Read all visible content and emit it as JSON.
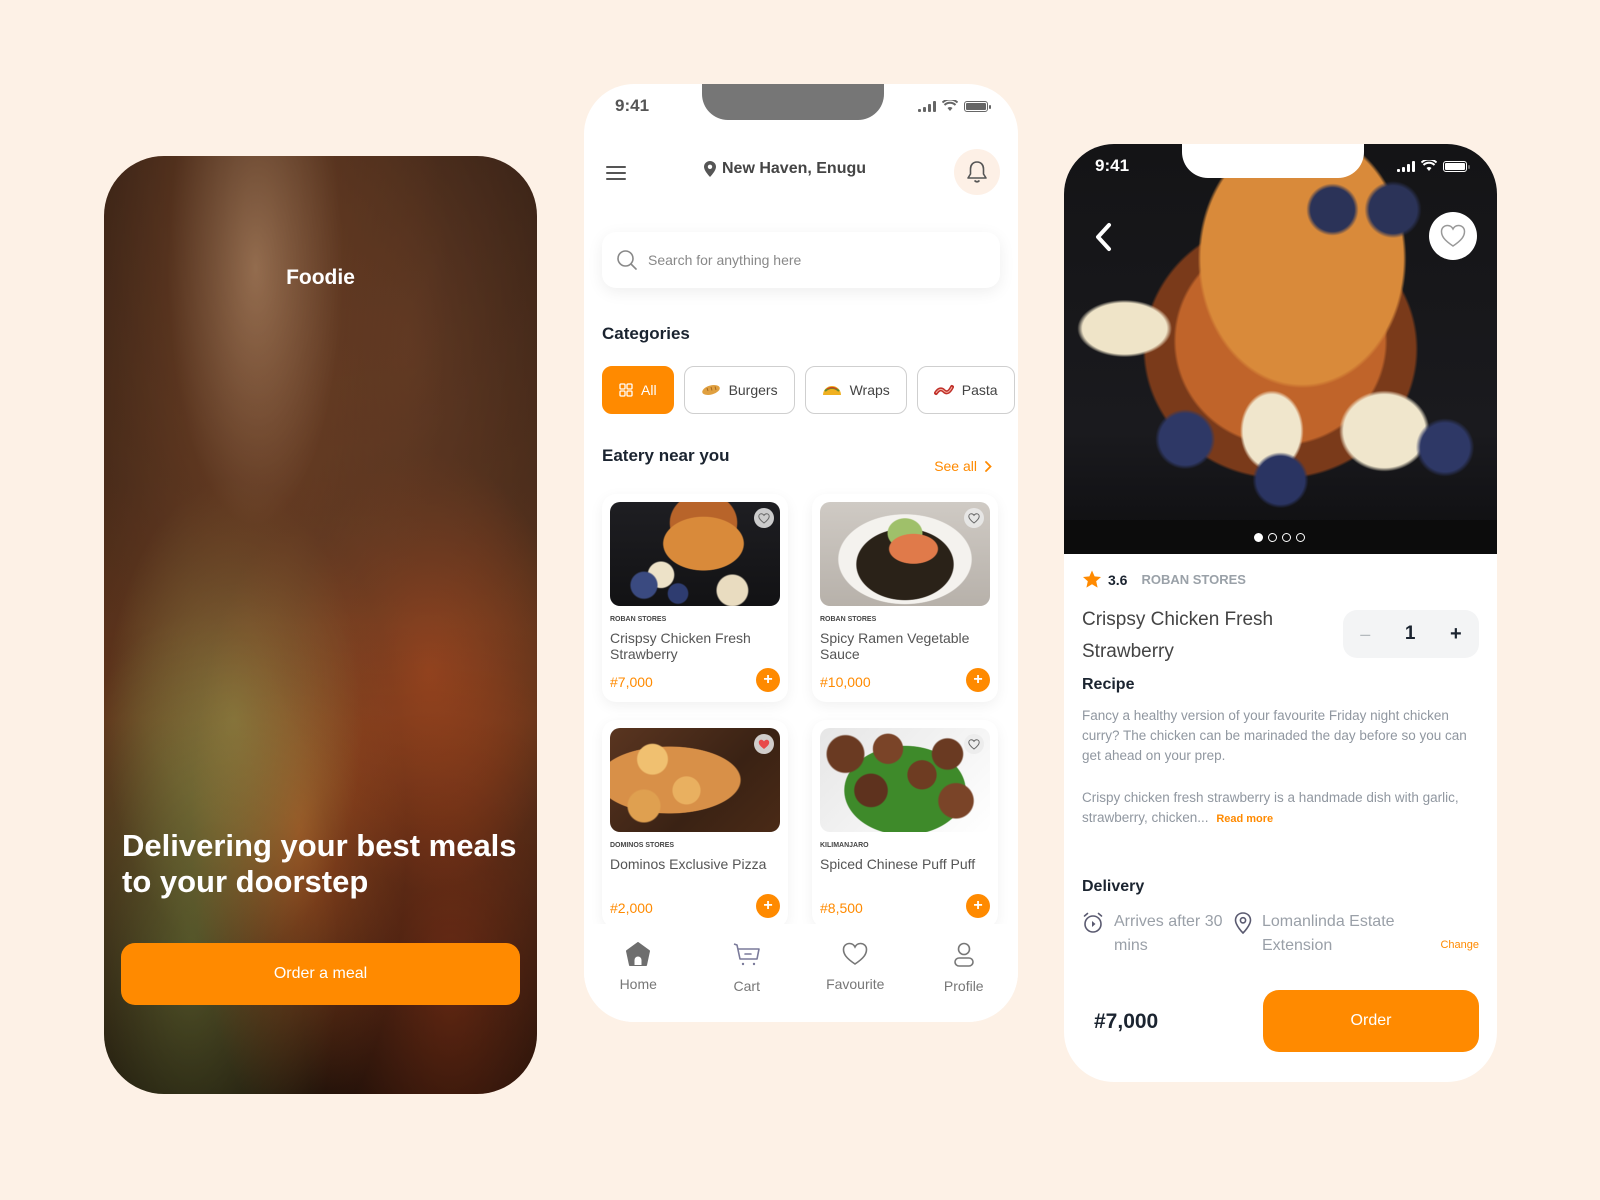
{
  "splash": {
    "brand": "Foodie",
    "headline": "Delivering your best meals to your doorstep",
    "cta_label": "Order a meal"
  },
  "home": {
    "status_time": "9:41",
    "location": "New Haven, Enugu",
    "search": {
      "placeholder": "Search for anything here"
    },
    "categories_title": "Categories",
    "categories": [
      {
        "label": "All",
        "icon": "grid-icon",
        "active": true
      },
      {
        "label": "Burgers",
        "icon": "bread-emoji",
        "active": false
      },
      {
        "label": "Wraps",
        "icon": "taco-emoji",
        "active": false
      },
      {
        "label": "Pasta",
        "icon": "bacon-emoji",
        "active": false
      }
    ],
    "eatery_title": "Eatery near you",
    "see_all_label": "See all",
    "eateries": [
      {
        "store": "ROBAN STORES",
        "name": "Crispsy Chicken Fresh Strawberry",
        "price": "#7,000",
        "favourited": false
      },
      {
        "store": "ROBAN STORES",
        "name": "Spicy Ramen Vegetable Sauce",
        "price": "#10,000",
        "favourited": false
      },
      {
        "store": "DOMINOS STORES",
        "name": "Dominos Exclusive Pizza",
        "price": "#2,000",
        "favourited": true
      },
      {
        "store": "KILIMANJARO",
        "name": "Spiced Chinese Puff Puff",
        "price": "#8,500",
        "favourited": false
      }
    ],
    "tabs": [
      {
        "label": "Home",
        "icon": "home-icon",
        "active": true
      },
      {
        "label": "Cart",
        "icon": "cart-icon",
        "active": false
      },
      {
        "label": "Favourite",
        "icon": "heart-icon",
        "active": false
      },
      {
        "label": "Profile",
        "icon": "profile-icon",
        "active": false
      }
    ]
  },
  "detail": {
    "status_time": "9:41",
    "carousel": {
      "total": 4,
      "active_index": 0
    },
    "rating": "3.6",
    "store": "ROBAN STORES",
    "name": "Crispsy Chicken Fresh Strawberry",
    "quantity": "1",
    "minus_label": "–",
    "plus_label": "+",
    "recipe_title": "Recipe",
    "recipe_p1": "Fancy a healthy version of your favourite Friday night chicken curry? The chicken can be marinaded the day before so you can get ahead on your prep.",
    "recipe_p2": "Crispy chicken fresh strawberry is a handmade dish with garlic, strawberry, chicken...",
    "read_more_label": "Read more",
    "delivery_title": "Delivery",
    "delivery_time": "Arrives after 30 mins",
    "delivery_address": "Lomanlinda Estate Extension",
    "change_label": "Change",
    "total": "#7,000",
    "order_label": "Order"
  },
  "colors": {
    "accent": "#ff8a00",
    "background": "#fdf1e6",
    "text_dark": "#1b2430",
    "text_muted": "#9097a0"
  }
}
